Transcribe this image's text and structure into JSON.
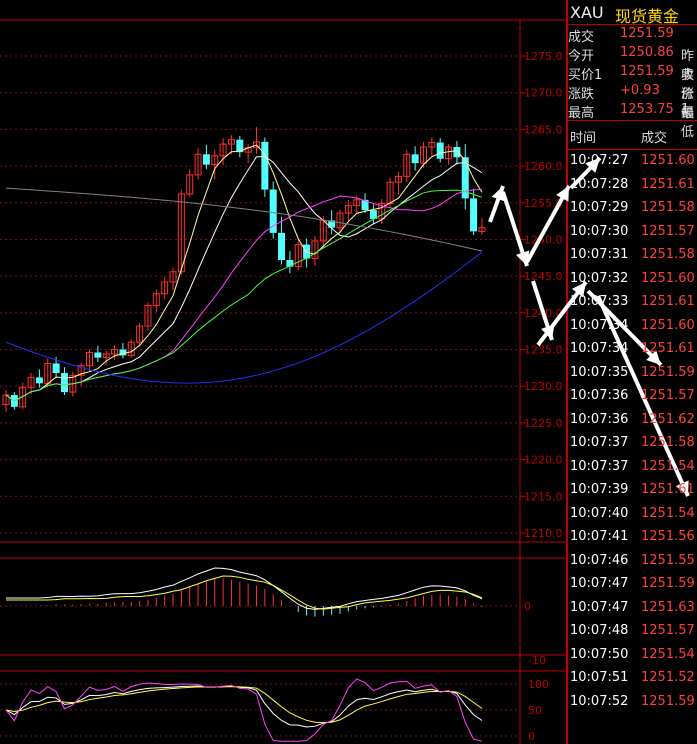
{
  "header": {
    "symbol": "XAU",
    "name": "现货黄金"
  },
  "quote": [
    {
      "label": "成交",
      "value": "1251.59",
      "label2": ""
    },
    {
      "label": "今开",
      "value": "1250.86",
      "label2": "昨收"
    },
    {
      "label": "买价1",
      "value": "1251.59",
      "label2": "卖价1"
    },
    {
      "label": "涨跌",
      "value": "+0.93",
      "label2": "涨幅"
    },
    {
      "label": "最高",
      "value": "1253.75",
      "label2": "最低"
    }
  ],
  "ticks_header": {
    "time": "时间",
    "price": "成交"
  },
  "ticks": [
    {
      "time": "10:07:27",
      "price": "1251.60"
    },
    {
      "time": "10:07:28",
      "price": "1251.61"
    },
    {
      "time": "10:07:29",
      "price": "1251.58"
    },
    {
      "time": "10:07:30",
      "price": "1251.57"
    },
    {
      "time": "10:07:31",
      "price": "1251.58"
    },
    {
      "time": "10:07:32",
      "price": "1251.60"
    },
    {
      "time": "10:07:33",
      "price": "1251.61"
    },
    {
      "time": "10:07:34",
      "price": "1251.60"
    },
    {
      "time": "10:07:34",
      "price": "1251.61"
    },
    {
      "time": "10:07:35",
      "price": "1251.59"
    },
    {
      "time": "10:07:36",
      "price": "1251.57"
    },
    {
      "time": "10:07:36",
      "price": "1251.62"
    },
    {
      "time": "10:07:37",
      "price": "1251.58"
    },
    {
      "time": "10:07:37",
      "price": "1251.54"
    },
    {
      "time": "10:07:39",
      "price": "1251.61"
    },
    {
      "time": "10:07:40",
      "price": "1251.54"
    },
    {
      "time": "10:07:41",
      "price": "1251.56"
    },
    {
      "time": "10:07:46",
      "price": "1251.55"
    },
    {
      "time": "10:07:47",
      "price": "1251.59"
    },
    {
      "time": "10:07:47",
      "price": "1251.63"
    },
    {
      "time": "10:07:48",
      "price": "1251.57"
    },
    {
      "time": "10:07:50",
      "price": "1251.54"
    },
    {
      "time": "10:07:51",
      "price": "1251.52"
    },
    {
      "time": "10:07:52",
      "price": "1251.59"
    }
  ],
  "chart_data": {
    "type": "candlestick",
    "price_axis": {
      "labels": [
        "1275.0",
        "1270.0",
        "1265.0",
        "1260.0",
        "1255.0",
        "1250.0",
        "1245.0",
        "1240.0",
        "1235.0",
        "1230.0",
        "1225.0",
        "1220.0",
        "1215.0",
        "1210.0"
      ],
      "ylim": [
        1210,
        1275
      ]
    },
    "macd_axis": {
      "labels": [
        "0"
      ]
    },
    "kdj_axis": {
      "labels": [
        "-10",
        "100",
        "50",
        "0"
      ]
    },
    "candles": [
      [
        1227.5,
        1229.5,
        1226.5,
        1228.8
      ],
      [
        1228.8,
        1229.2,
        1226.8,
        1227.2
      ],
      [
        1227.2,
        1230.5,
        1226.9,
        1229.8
      ],
      [
        1229.8,
        1231.8,
        1228.9,
        1231.2
      ],
      [
        1231.2,
        1232.3,
        1229.8,
        1230.4
      ],
      [
        1230.4,
        1233.8,
        1229.9,
        1233.1
      ],
      [
        1233.1,
        1234.0,
        1231.1,
        1231.8
      ],
      [
        1231.8,
        1232.6,
        1228.8,
        1229.2
      ],
      [
        1229.2,
        1232.0,
        1228.6,
        1231.5
      ],
      [
        1231.5,
        1233.2,
        1230.0,
        1232.8
      ],
      [
        1232.8,
        1235.0,
        1232.1,
        1234.6
      ],
      [
        1234.6,
        1235.5,
        1233.3,
        1233.9
      ],
      [
        1233.9,
        1234.8,
        1233.0,
        1234.4
      ],
      [
        1234.4,
        1235.6,
        1233.6,
        1235.0
      ],
      [
        1235.0,
        1235.9,
        1233.8,
        1234.2
      ],
      [
        1234.2,
        1236.4,
        1233.9,
        1236.0
      ],
      [
        1236.0,
        1238.6,
        1235.4,
        1238.2
      ],
      [
        1238.2,
        1241.4,
        1237.6,
        1241.0
      ],
      [
        1241.0,
        1243.2,
        1240.1,
        1242.6
      ],
      [
        1242.6,
        1244.9,
        1241.9,
        1244.2
      ],
      [
        1244.2,
        1246.2,
        1243.1,
        1245.6
      ],
      [
        1245.6,
        1256.8,
        1245.2,
        1256.2
      ],
      [
        1256.2,
        1259.6,
        1255.8,
        1258.8
      ],
      [
        1258.8,
        1262.5,
        1258.2,
        1261.6
      ],
      [
        1261.6,
        1262.9,
        1259.6,
        1260.2
      ],
      [
        1260.2,
        1262.2,
        1258.2,
        1261.4
      ],
      [
        1261.4,
        1263.8,
        1260.1,
        1263.0
      ],
      [
        1263.0,
        1264.2,
        1261.6,
        1263.6
      ],
      [
        1263.6,
        1264.1,
        1261.2,
        1261.9
      ],
      [
        1261.9,
        1263.0,
        1260.4,
        1262.5
      ],
      [
        1262.5,
        1265.3,
        1261.7,
        1263.3
      ],
      [
        1263.3,
        1263.9,
        1255.8,
        1256.8
      ],
      [
        1256.8,
        1257.9,
        1250.1,
        1250.9
      ],
      [
        1250.9,
        1253.1,
        1246.6,
        1247.2
      ],
      [
        1247.2,
        1248.4,
        1245.4,
        1246.3
      ],
      [
        1246.3,
        1250.0,
        1245.8,
        1249.3
      ],
      [
        1249.3,
        1250.1,
        1246.2,
        1247.4
      ],
      [
        1247.4,
        1250.5,
        1246.4,
        1249.8
      ],
      [
        1249.8,
        1253.2,
        1248.8,
        1252.6
      ],
      [
        1252.6,
        1254.0,
        1250.7,
        1251.6
      ],
      [
        1251.6,
        1254.1,
        1250.8,
        1253.6
      ],
      [
        1253.6,
        1255.4,
        1252.4,
        1254.6
      ],
      [
        1254.6,
        1256.0,
        1253.6,
        1255.4
      ],
      [
        1255.4,
        1256.3,
        1253.6,
        1254.0
      ],
      [
        1254.0,
        1254.8,
        1252.1,
        1252.8
      ],
      [
        1252.8,
        1255.5,
        1252.1,
        1254.9
      ],
      [
        1254.9,
        1258.4,
        1254.3,
        1257.8
      ],
      [
        1257.8,
        1259.2,
        1256.1,
        1258.6
      ],
      [
        1258.6,
        1262.2,
        1257.8,
        1261.6
      ],
      [
        1261.6,
        1262.7,
        1259.4,
        1260.4
      ],
      [
        1260.4,
        1263.3,
        1259.8,
        1262.6
      ],
      [
        1262.6,
        1263.9,
        1261.4,
        1263.2
      ],
      [
        1263.2,
        1263.8,
        1260.5,
        1261.0
      ],
      [
        1261.0,
        1263.0,
        1260.2,
        1262.6
      ],
      [
        1262.6,
        1263.4,
        1260.2,
        1261.2
      ],
      [
        1261.2,
        1263.0,
        1254.1,
        1255.6
      ],
      [
        1255.6,
        1256.9,
        1250.6,
        1251.1
      ],
      [
        1251.1,
        1252.9,
        1250.6,
        1251.6
      ]
    ]
  }
}
